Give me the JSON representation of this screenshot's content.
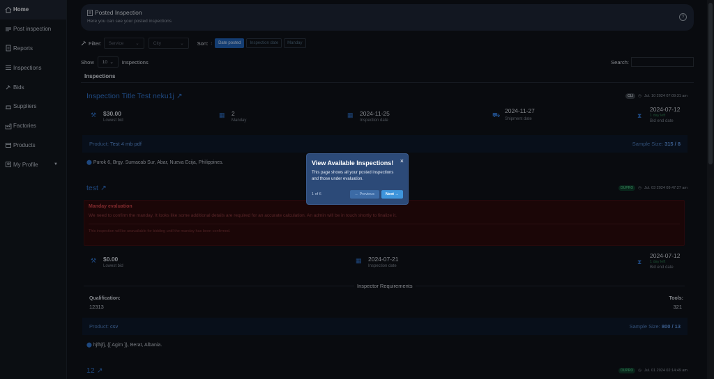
{
  "sidebar": {
    "items": [
      {
        "label": "Home",
        "icon": "home-icon"
      },
      {
        "label": "Post inspection",
        "icon": "post-icon"
      },
      {
        "label": "Reports",
        "icon": "reports-icon"
      },
      {
        "label": "Inspections",
        "icon": "inspections-icon"
      },
      {
        "label": "Bids",
        "icon": "bids-icon"
      },
      {
        "label": "Suppliers",
        "icon": "suppliers-icon"
      },
      {
        "label": "Factories",
        "icon": "factories-icon"
      },
      {
        "label": "Products",
        "icon": "products-icon"
      },
      {
        "label": "My Profile",
        "icon": "profile-icon"
      }
    ]
  },
  "header": {
    "title": "Posted Inspection",
    "subtitle": "Here you can see your posted inspections"
  },
  "filters": {
    "filter_label": "Filter:",
    "service_placeholder": "Service",
    "city_placeholder": "City",
    "sort_label": "Sort:",
    "sort_options": [
      "Date posted",
      "Inspection date",
      "Manday"
    ]
  },
  "list": {
    "show_label": "Show",
    "page_size": "10",
    "inspections_label": "Inspections",
    "search_label": "Search:",
    "heading": "Inspections"
  },
  "inspection1": {
    "title": "Inspection Title Test neku1j",
    "badge": "CLI",
    "posted": "Jul. 10 2024 07:09:31 am",
    "lowest_bid_value": "$30.00",
    "lowest_bid_label": "Lowest bid",
    "manday_value": "2",
    "manday_label": "Manday",
    "inspection_date_value": "2024-11-25",
    "inspection_date_label": "Inspection date",
    "shipment_date_value": "2024-11-27",
    "shipment_date_label": "Shipment date",
    "bid_end_value": "2024-07-12",
    "bid_end_status": "1 day left",
    "bid_end_label": "Bid end date",
    "product_label": "Product:",
    "product_value": "Test 4 mb pdf",
    "sample_label": "Sample Size:",
    "sample_value": "315 / 8",
    "address": "Purok 6, Brgy. Sumacab Sur, Abar, Nueva Ecija, Philippines."
  },
  "inspection2": {
    "title": "test",
    "badge": "DUPRO",
    "posted": "Jul. 03 2024 09:47:27 am",
    "alert_title": "Manday evaluation",
    "alert_body": "We need to confirm the manday. It looks like some additional details are required for an accurate calculation. An admin will be in touch shortly to finalize it.",
    "alert_note": "This inspection will be unavailable for bidding until the manday has been confirmed.",
    "lowest_bid_value": "$0.00",
    "lowest_bid_label": "Lowest bid",
    "inspection_date_value": "2024-07-21",
    "inspection_date_label": "Inspection date",
    "bid_end_value": "2024-07-12",
    "bid_end_status": "1 day left",
    "bid_end_label": "Bid end date",
    "requirements_heading": "Inspector Requirements",
    "qualification_label": "Qualification:",
    "qualification_value": "12313",
    "tools_label": "Tools:",
    "tools_value": "321",
    "product_label": "Product:",
    "product_value": "csv",
    "sample_label": "Sample Size:",
    "sample_value": "800 / 13",
    "address": "hjfhjfj, {{ Agim }}, Berat, Albania."
  },
  "inspection3": {
    "title": "12",
    "badge": "DUPRO",
    "posted": "Jul. 01 2024 02:14:49 am"
  },
  "tour": {
    "title": "View Available Inspections!",
    "body": "This page shows all your posted inspections and those under evaluation.",
    "counter": "1 of 6",
    "prev_label": "← Previous",
    "next_label": "Next →",
    "close_symbol": "×"
  },
  "colors": {
    "accent": "#2f6fc3",
    "tour_bg": "#2c4a78",
    "alert_red": "#c54146"
  }
}
